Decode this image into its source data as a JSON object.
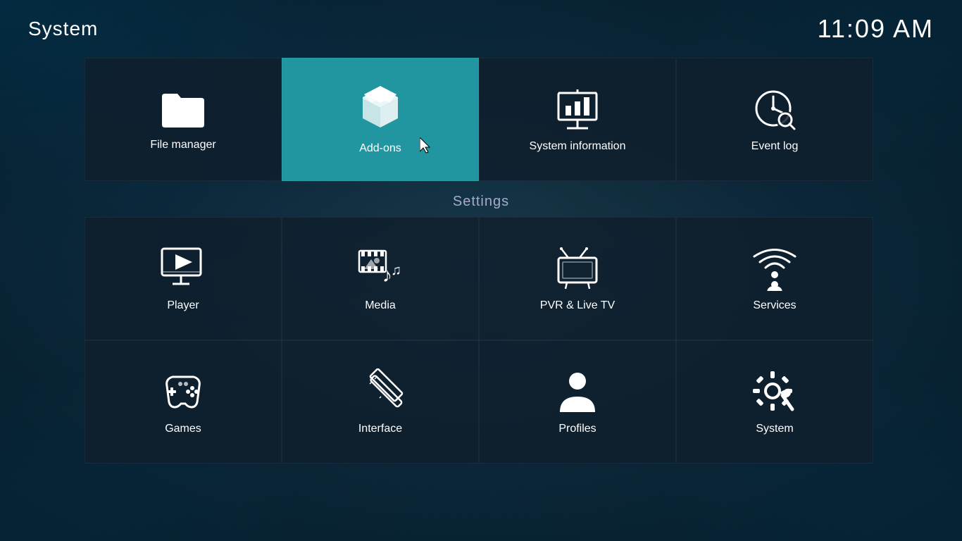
{
  "header": {
    "title": "System",
    "time": "11:09 AM"
  },
  "settings_label": "Settings",
  "top_row": [
    {
      "id": "file-manager",
      "label": "File manager",
      "active": false
    },
    {
      "id": "add-ons",
      "label": "Add-ons",
      "active": true
    },
    {
      "id": "system-information",
      "label": "System information",
      "active": false
    },
    {
      "id": "event-log",
      "label": "Event log",
      "active": false
    }
  ],
  "settings_row1": [
    {
      "id": "player",
      "label": "Player"
    },
    {
      "id": "media",
      "label": "Media"
    },
    {
      "id": "pvr-live-tv",
      "label": "PVR & Live TV"
    },
    {
      "id": "services",
      "label": "Services"
    }
  ],
  "settings_row2": [
    {
      "id": "games",
      "label": "Games"
    },
    {
      "id": "interface",
      "label": "Interface"
    },
    {
      "id": "profiles",
      "label": "Profiles"
    },
    {
      "id": "system",
      "label": "System"
    }
  ]
}
